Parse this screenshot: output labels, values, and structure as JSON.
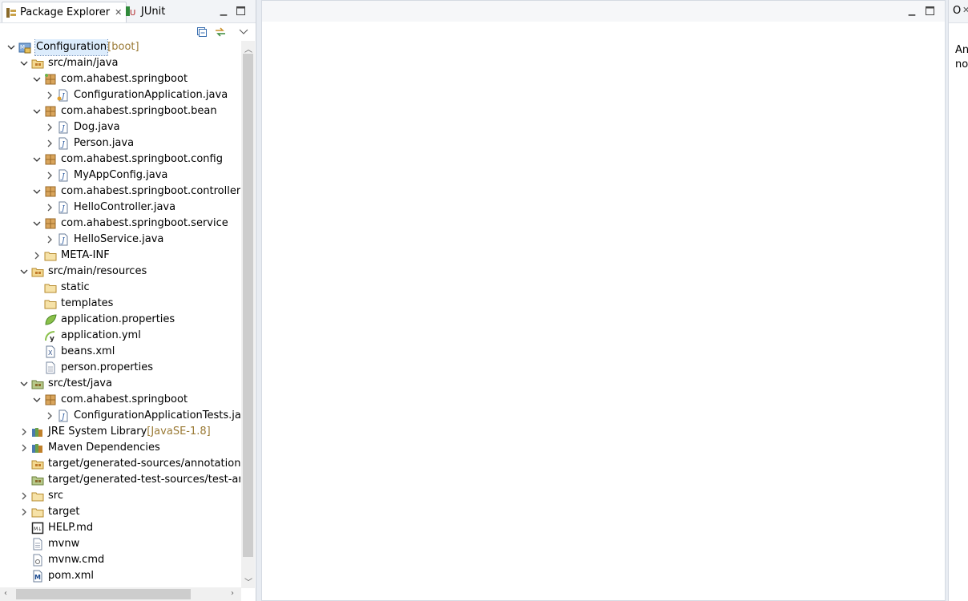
{
  "tabs": {
    "package_explorer": "Package Explorer",
    "junit": "JUnit",
    "outline_short": "O"
  },
  "outline": {
    "line1": "An",
    "line2": "no"
  },
  "tree": [
    {
      "label": "Configuration",
      "deco": " [boot]",
      "level": 0,
      "chevron": "down",
      "icon": "project",
      "selected": true
    },
    {
      "label": "src/main/java",
      "level": 1,
      "chevron": "down",
      "icon": "src-folder"
    },
    {
      "label": "com.ahabest.springboot",
      "level": 2,
      "chevron": "down",
      "icon": "package-boot"
    },
    {
      "label": "ConfigurationApplication.java",
      "level": 3,
      "chevron": "right",
      "icon": "java-boot"
    },
    {
      "label": "com.ahabest.springboot.bean",
      "level": 2,
      "chevron": "down",
      "icon": "package"
    },
    {
      "label": "Dog.java",
      "level": 3,
      "chevron": "right",
      "icon": "java"
    },
    {
      "label": "Person.java",
      "level": 3,
      "chevron": "right",
      "icon": "java"
    },
    {
      "label": "com.ahabest.springboot.config",
      "level": 2,
      "chevron": "down",
      "icon": "package"
    },
    {
      "label": "MyAppConfig.java",
      "level": 3,
      "chevron": "right",
      "icon": "java"
    },
    {
      "label": "com.ahabest.springboot.controller",
      "level": 2,
      "chevron": "down",
      "icon": "package"
    },
    {
      "label": "HelloController.java",
      "level": 3,
      "chevron": "right",
      "icon": "java"
    },
    {
      "label": "com.ahabest.springboot.service",
      "level": 2,
      "chevron": "down",
      "icon": "package"
    },
    {
      "label": "HelloService.java",
      "level": 3,
      "chevron": "right",
      "icon": "java"
    },
    {
      "label": "META-INF",
      "level": 2,
      "chevron": "right",
      "icon": "folder"
    },
    {
      "label": "src/main/resources",
      "level": 1,
      "chevron": "down",
      "icon": "src-folder"
    },
    {
      "label": "static",
      "level": 2,
      "chevron": "none",
      "icon": "folder"
    },
    {
      "label": "templates",
      "level": 2,
      "chevron": "none",
      "icon": "folder"
    },
    {
      "label": "application.properties",
      "level": 2,
      "chevron": "none",
      "icon": "leaf"
    },
    {
      "label": "application.yml",
      "level": 2,
      "chevron": "none",
      "icon": "yml"
    },
    {
      "label": "beans.xml",
      "level": 2,
      "chevron": "none",
      "icon": "xml"
    },
    {
      "label": "person.properties",
      "level": 2,
      "chevron": "none",
      "icon": "file"
    },
    {
      "label": "src/test/java",
      "level": 1,
      "chevron": "down",
      "icon": "src-test"
    },
    {
      "label": "com.ahabest.springboot",
      "level": 2,
      "chevron": "down",
      "icon": "package"
    },
    {
      "label": "ConfigurationApplicationTests.java",
      "level": 3,
      "chevron": "right",
      "icon": "java"
    },
    {
      "label": "JRE System Library",
      "deco": " [JavaSE-1.8]",
      "level": 1,
      "chevron": "right",
      "icon": "library"
    },
    {
      "label": "Maven Dependencies",
      "level": 1,
      "chevron": "right",
      "icon": "library"
    },
    {
      "label": "target/generated-sources/annotations",
      "level": 1,
      "chevron": "none",
      "icon": "src-folder"
    },
    {
      "label": "target/generated-test-sources/test-annot",
      "level": 1,
      "chevron": "none",
      "icon": "src-test"
    },
    {
      "label": "src",
      "level": 1,
      "chevron": "right",
      "icon": "folder"
    },
    {
      "label": "target",
      "level": 1,
      "chevron": "right",
      "icon": "folder"
    },
    {
      "label": "HELP.md",
      "level": 1,
      "chevron": "none",
      "icon": "md"
    },
    {
      "label": "mvnw",
      "level": 1,
      "chevron": "none",
      "icon": "file"
    },
    {
      "label": "mvnw.cmd",
      "level": 1,
      "chevron": "none",
      "icon": "cmd"
    },
    {
      "label": "pom.xml",
      "level": 1,
      "chevron": "none",
      "icon": "pom"
    }
  ]
}
